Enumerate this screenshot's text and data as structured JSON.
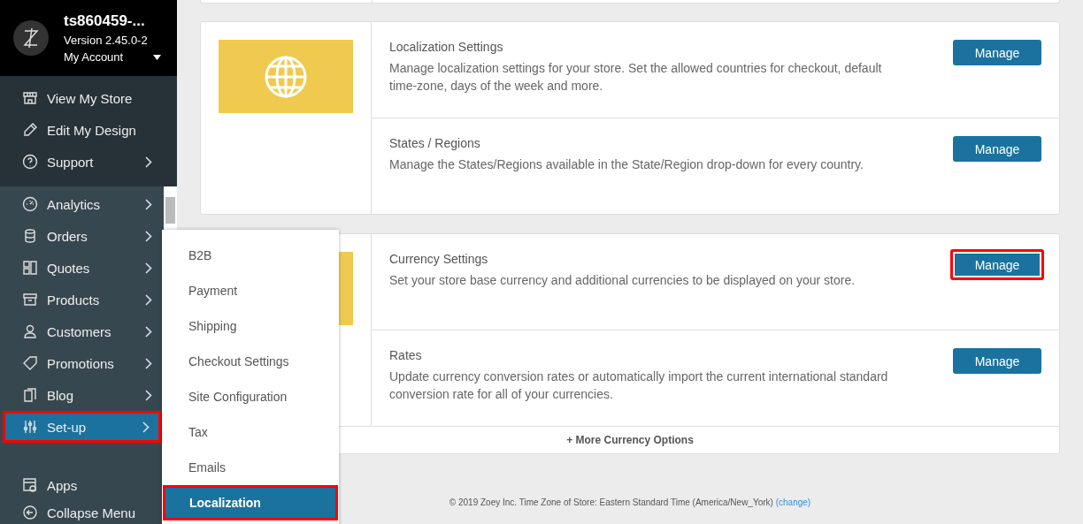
{
  "account": {
    "store": "ts860459-...",
    "version": "Version 2.45.0-2",
    "menu": "My Account"
  },
  "top_items": [
    {
      "label": "View My Store",
      "has_arrow": false
    },
    {
      "label": "Edit My Design",
      "has_arrow": false
    },
    {
      "label": "Support",
      "has_arrow": true
    }
  ],
  "nav_items": [
    {
      "label": "Analytics",
      "selected": false,
      "highlighted": false
    },
    {
      "label": "Orders",
      "selected": false,
      "highlighted": false
    },
    {
      "label": "Quotes",
      "selected": false,
      "highlighted": false
    },
    {
      "label": "Products",
      "selected": false,
      "highlighted": false
    },
    {
      "label": "Customers",
      "selected": false,
      "highlighted": false
    },
    {
      "label": "Promotions",
      "selected": false,
      "highlighted": false
    },
    {
      "label": "Blog",
      "selected": false,
      "highlighted": false
    },
    {
      "label": "Set-up",
      "selected": true,
      "highlighted": true
    }
  ],
  "bottom_items": [
    {
      "label": "Apps"
    },
    {
      "label": "Collapse Menu"
    }
  ],
  "flyout": [
    {
      "label": "B2B",
      "selected": false,
      "highlighted": false
    },
    {
      "label": "Payment",
      "selected": false,
      "highlighted": false
    },
    {
      "label": "Shipping",
      "selected": false,
      "highlighted": false
    },
    {
      "label": "Checkout Settings",
      "selected": false,
      "highlighted": false
    },
    {
      "label": "Site Configuration",
      "selected": false,
      "highlighted": false
    },
    {
      "label": "Tax",
      "selected": false,
      "highlighted": false
    },
    {
      "label": "Emails",
      "selected": false,
      "highlighted": false
    },
    {
      "label": "Localization",
      "selected": true,
      "highlighted": true
    }
  ],
  "cards": [
    {
      "kind": "globe",
      "rows": [
        {
          "title": "Localization Settings",
          "description": "Manage localization settings for your store. Set the allowed countries for checkout, default time-zone, days of the week and more.",
          "button": "Manage",
          "highlighted": false
        },
        {
          "title": "States / Regions",
          "description": "Manage the States/Regions available in the State/Region drop-down for every country.",
          "button": "Manage",
          "highlighted": false
        }
      ]
    },
    {
      "kind": "plain",
      "rows": [
        {
          "title": "Currency Settings",
          "description": "Set your store base currency and additional currencies to be displayed on your store.",
          "button": "Manage",
          "highlighted": true
        },
        {
          "title": "Rates",
          "description": "Update currency conversion rates or automatically import the current international standard conversion rate for all of your currencies.",
          "button": "Manage",
          "highlighted": false
        }
      ],
      "more": "+ More Currency Options"
    }
  ],
  "footer": {
    "text": "© 2019 Zoey Inc. Time Zone of Store: Eastern Standard Time (America/New_York)",
    "link": "(change)"
  }
}
